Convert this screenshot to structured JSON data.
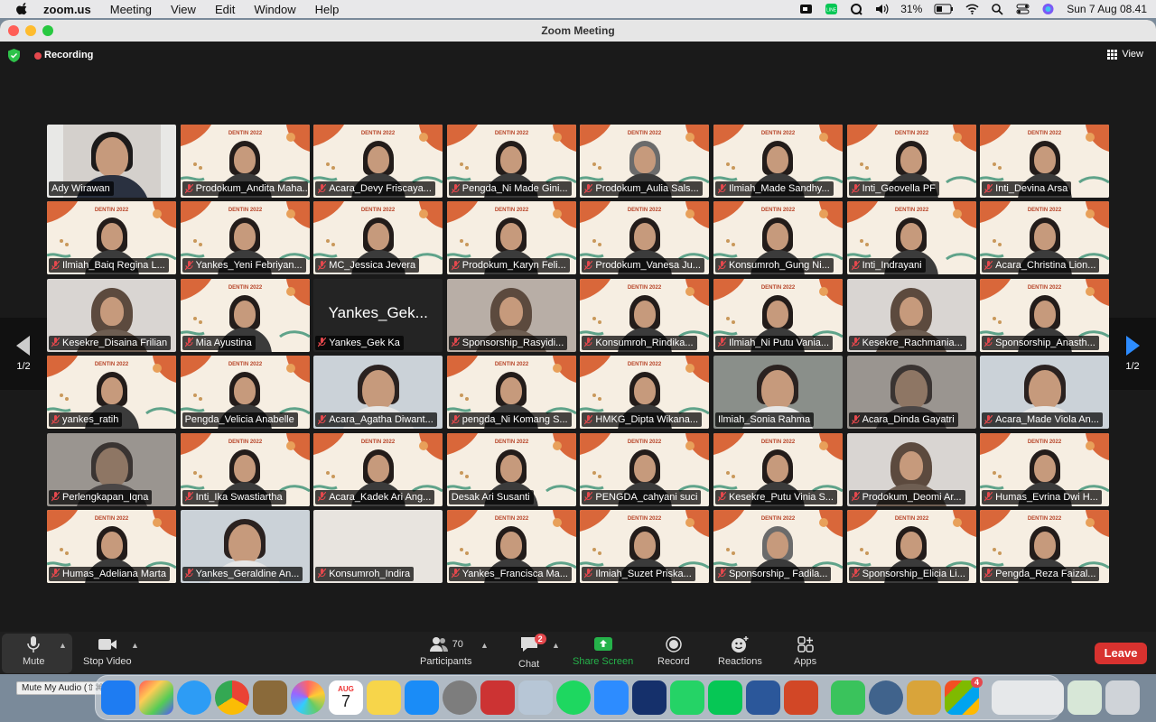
{
  "menubar": {
    "app_name": "zoom.us",
    "items": [
      "Meeting",
      "View",
      "Edit",
      "Window",
      "Help"
    ],
    "battery_percent": "31%",
    "datetime": "Sun 7 Aug  08.41"
  },
  "window": {
    "title": "Zoom Meeting",
    "recording_label": "Recording",
    "view_label": "View"
  },
  "pager": {
    "left_label": "1/2",
    "right_label": "1/2"
  },
  "participants": [
    {
      "name": "Ady Wirawan",
      "style": "camera-man",
      "muted": false
    },
    {
      "name": "Prodokum_Andita Maha...",
      "style": "slide",
      "muted": true
    },
    {
      "name": "Acara_Devy Friscaya...",
      "style": "slide",
      "muted": true
    },
    {
      "name": "Pengda_Ni Made Gini...",
      "style": "slide",
      "muted": true
    },
    {
      "name": "Prodokum_Aulia Sals...",
      "style": "slide-hijab",
      "muted": true
    },
    {
      "name": "Ilmiah_Made Sandhy...",
      "style": "slide",
      "muted": true
    },
    {
      "name": "Inti_Geovella PF",
      "style": "slide",
      "muted": true
    },
    {
      "name": "Inti_Devina Arsa",
      "style": "slide",
      "muted": true
    },
    {
      "name": "Ilmiah_Baiq Regina L...",
      "style": "slide",
      "muted": true
    },
    {
      "name": "Yankes_Yeni Febriyan...",
      "style": "slide",
      "muted": true
    },
    {
      "name": "MC_Jessica Jevera",
      "style": "slide",
      "muted": true,
      "active": true
    },
    {
      "name": "Prodokum_Karyn Feli...",
      "style": "slide",
      "muted": true
    },
    {
      "name": "Prodokum_Vanesa Ju...",
      "style": "slide",
      "muted": true
    },
    {
      "name": "Konsumroh_Gung Ni...",
      "style": "slide",
      "muted": true
    },
    {
      "name": "Inti_Indrayani",
      "style": "slide",
      "muted": true
    },
    {
      "name": "Acara_Christina Lion...",
      "style": "slide",
      "muted": true
    },
    {
      "name": "Kesekre_Disaina Frilian",
      "style": "wall-hijab",
      "muted": true
    },
    {
      "name": "Mia Ayustina",
      "style": "slide",
      "muted": true
    },
    {
      "name": "Yankes_Gek Ka",
      "style": "dark",
      "bigname": "Yankes_Gek...",
      "muted": true
    },
    {
      "name": "Sponsorship_Rasyidi...",
      "style": "photo-hijab",
      "muted": true
    },
    {
      "name": "Konsumroh_Rindika...",
      "style": "slide",
      "muted": true
    },
    {
      "name": "Ilmiah_Ni Putu Vania...",
      "style": "slide",
      "muted": true
    },
    {
      "name": "Kesekre_Rachmania...",
      "style": "wall-hijab",
      "muted": true
    },
    {
      "name": "Sponsorship_Anasth...",
      "style": "slide",
      "muted": true
    },
    {
      "name": "yankes_ratih",
      "style": "slide",
      "muted": true
    },
    {
      "name": "Pengda_Velicia Anabelle",
      "style": "slide-dark",
      "muted": false
    },
    {
      "name": "Acara_Agatha Diwant...",
      "style": "photo",
      "muted": true
    },
    {
      "name": "pengda_Ni Komang S...",
      "style": "slide",
      "muted": true
    },
    {
      "name": "HMKG_Dipta Wikana...",
      "style": "slide",
      "muted": true
    },
    {
      "name": "Ilmiah_Sonia Rahma",
      "style": "photo-room",
      "muted": false
    },
    {
      "name": "Acara_Dinda Gayatri",
      "style": "photo-dim",
      "muted": true
    },
    {
      "name": "Acara_Made Viola An...",
      "style": "photo",
      "muted": true
    },
    {
      "name": "Perlengkapan_Iqna",
      "style": "photo-dim",
      "muted": true
    },
    {
      "name": "Inti_Ika Swastiartha",
      "style": "slide",
      "muted": true
    },
    {
      "name": "Acara_Kadek Ari Ang...",
      "style": "slide",
      "muted": true
    },
    {
      "name": "Desak Ari Susanti",
      "style": "slide",
      "muted": false
    },
    {
      "name": "PENGDA_cahyani suci",
      "style": "slide",
      "muted": true
    },
    {
      "name": "Kesekre_Putu Vinia S...",
      "style": "slide",
      "muted": true
    },
    {
      "name": "Prodokum_Deomi Ar...",
      "style": "wall-hijab",
      "muted": true
    },
    {
      "name": "Humas_Evrina Dwi H...",
      "style": "slide",
      "muted": true
    },
    {
      "name": "Humas_Adeliana Marta",
      "style": "slide",
      "muted": true
    },
    {
      "name": "Yankes_Geraldine An...",
      "style": "photo",
      "muted": true
    },
    {
      "name": "Konsumroh_Indira",
      "style": "plain",
      "muted": true
    },
    {
      "name": "Yankes_Francisca Ma...",
      "style": "slide",
      "muted": true
    },
    {
      "name": "Ilmiah_Suzet Priska...",
      "style": "slide",
      "muted": true
    },
    {
      "name": "Sponsorship_ Fadila...",
      "style": "slide-hijab",
      "muted": true
    },
    {
      "name": "Sponsorship_Elicia Li...",
      "style": "slide",
      "muted": true
    },
    {
      "name": "Pengda_Reza Faizal...",
      "style": "slide",
      "muted": true
    }
  ],
  "slide_text": "DENTIN 2022",
  "toolbar": {
    "mute_label": "Mute",
    "stop_video_label": "Stop Video",
    "participants_label": "Participants",
    "participants_count": "70",
    "chat_label": "Chat",
    "chat_badge": "2",
    "share_label": "Share Screen",
    "record_label": "Record",
    "reactions_label": "Reactions",
    "apps_label": "Apps",
    "leave_label": "Leave",
    "tooltip": "Mute My Audio (⇧⌘A)"
  },
  "dock": {
    "calendar_month": "AUG",
    "calendar_day": "7",
    "badge": "4"
  },
  "colors": {
    "accent_green": "#2ec24a",
    "record_red": "#e5484d",
    "leave_red": "#d8322f",
    "share_green": "#25b24a"
  }
}
